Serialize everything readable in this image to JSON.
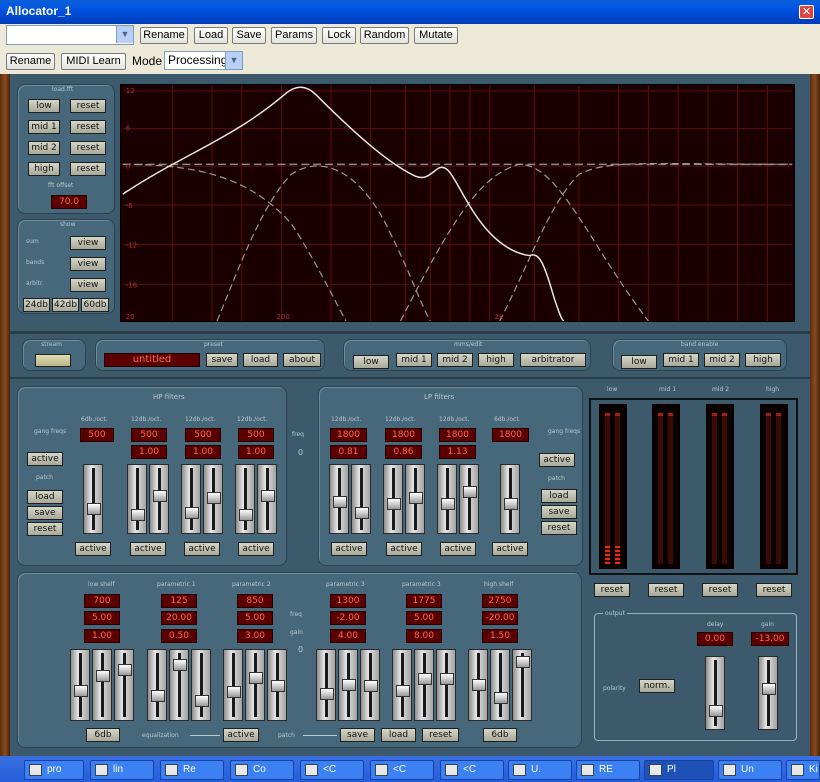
{
  "window": {
    "title": "Allocator_1",
    "close": "✕"
  },
  "toolbar1": {
    "preset_value": "",
    "buttons": [
      "Rename",
      "Load",
      "Save",
      "Params",
      "Lock",
      "Random",
      "Mutate"
    ]
  },
  "toolbar2": {
    "rename": "Rename",
    "midi_learn": "MIDI Learn",
    "mode_label": "Mode",
    "mode_value": "Processing"
  },
  "fft": {
    "label": "load.fft",
    "rows": [
      {
        "band": "low",
        "reset": "reset"
      },
      {
        "band": "mid 1",
        "reset": "reset"
      },
      {
        "band": "mid 2",
        "reset": "reset"
      },
      {
        "band": "high",
        "reset": "reset"
      }
    ],
    "offset_label": "fft offset",
    "offset_value": "70.0"
  },
  "show": {
    "label": "show",
    "rows": [
      {
        "name": "sum",
        "btn": "view"
      },
      {
        "name": "bands",
        "btn": "view"
      },
      {
        "name": "arbitr.",
        "btn": "view"
      }
    ],
    "db": [
      "24db",
      "42db",
      "60db"
    ]
  },
  "graph": {
    "y_ticks": [
      "12",
      "6",
      "0",
      "-6",
      "-12",
      "-18"
    ],
    "x_ticks": [
      "20",
      "200",
      "2k"
    ]
  },
  "stream": {
    "label": "stream"
  },
  "preset": {
    "label": "preset",
    "name": "untitled",
    "save": "save",
    "load": "load",
    "about": "about"
  },
  "mmsedit": {
    "label": "mms/edit",
    "buttons": [
      "low",
      "mid 1",
      "mid 2",
      "high",
      "arbitrator"
    ]
  },
  "bandenable": {
    "label": "band enable",
    "buttons": [
      "low",
      "mid 1",
      "mid 2",
      "high"
    ]
  },
  "hp": {
    "label": "HP filters",
    "gang": "gang freqs",
    "active": "active",
    "patch": "patch",
    "load": "load",
    "save": "save",
    "reset": "reset",
    "cols": [
      {
        "slope": "6db./oct.",
        "freq": "500",
        "q": ""
      },
      {
        "slope": "12db./oct.",
        "freq": "500",
        "q": "1.00"
      },
      {
        "slope": "12db./oct.",
        "freq": "500",
        "q": "1.00"
      },
      {
        "slope": "12db./oct.",
        "freq": "500",
        "q": "1.00"
      }
    ],
    "freq_label": "freq",
    "freq_val": "0",
    "col_active": "active"
  },
  "lp": {
    "label": "LP filters",
    "gang": "gang freqs",
    "active": "active",
    "patch": "patch",
    "load": "load",
    "save": "save",
    "reset": "reset",
    "cols": [
      {
        "slope": "12db./oct.",
        "freq": "1800",
        "q": "0.81"
      },
      {
        "slope": "12db./oct.",
        "freq": "1800",
        "q": "0.86"
      },
      {
        "slope": "12db./oct.",
        "freq": "1800",
        "q": "1.13"
      },
      {
        "slope": "6db./oct.",
        "freq": "1800",
        "q": ""
      }
    ],
    "col_active": "active"
  },
  "meters": {
    "labels": [
      "low",
      "mid 1",
      "mid 2",
      "high"
    ],
    "reset": "reset",
    "levels": [
      0.12,
      0,
      0,
      0
    ]
  },
  "eq": {
    "bands": [
      {
        "name": "low shelf",
        "freq": "700",
        "gain": "5.00",
        "q": "1.00"
      },
      {
        "name": "parametric 1",
        "freq": "125",
        "gain": "20.00",
        "q": "0.50"
      },
      {
        "name": "parametric 2",
        "freq": "850",
        "gain": "5.00",
        "q": "3.00"
      },
      {
        "name": "parametric 3",
        "freq": "1300",
        "gain": "-2.00",
        "q": "4.00"
      },
      {
        "name": "parametric 3",
        "freq": "1775",
        "gain": "5.00",
        "q": "8.00"
      },
      {
        "name": "high shelf",
        "freq": "2750",
        "gain": "-20.00",
        "q": "1.50"
      }
    ],
    "freq_label": "freq",
    "gain_label": "gain",
    "mid_val": "0",
    "db6a": "6db",
    "db6b": "6db",
    "equalization": "equalization",
    "active": "active",
    "patch": "patch",
    "save": "save",
    "load": "load",
    "reset": "reset"
  },
  "output": {
    "label": "output",
    "delay_label": "delay",
    "delay": "0.00",
    "gain_label": "gain",
    "gain": "-13.00",
    "polarity": "polarity",
    "norm": "norm."
  },
  "taskbar": [
    "pro",
    "lin",
    "Re",
    "Co",
    "<C",
    "<C",
    "<C",
    "U.",
    "RE",
    "Pl",
    "Un",
    "Ki"
  ],
  "colors": {
    "accent": "#ff6a50",
    "panel": "#47677a",
    "graph_bg": "#1a0000"
  }
}
